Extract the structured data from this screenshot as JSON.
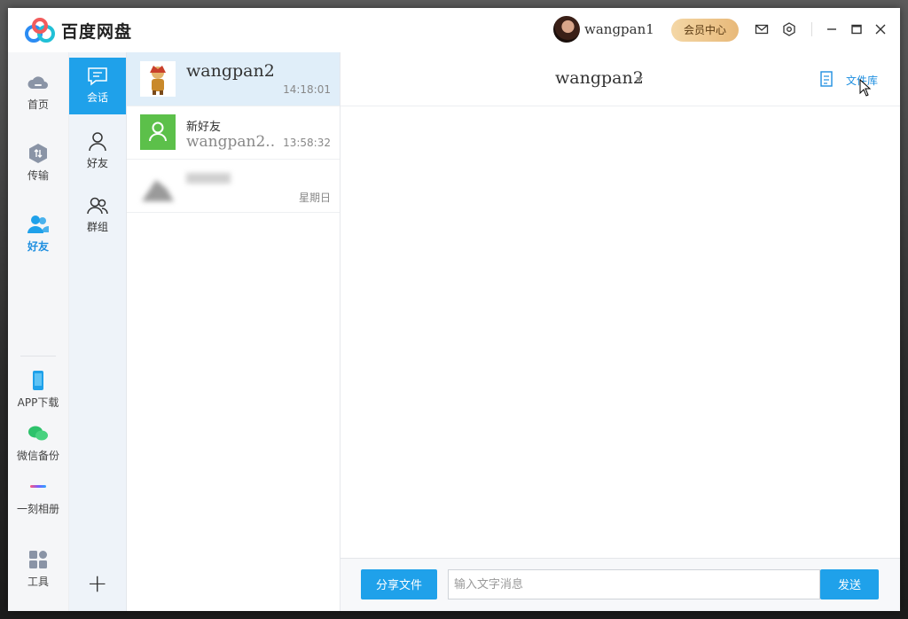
{
  "app": {
    "brand": "百度网盘"
  },
  "header": {
    "username": "wangpan1",
    "vip_label": "会员中心",
    "icons": [
      "mail-icon",
      "gear-icon",
      "minimize-icon",
      "maximize-icon",
      "close-icon"
    ]
  },
  "leftnav": {
    "items": [
      {
        "label": "首页",
        "icon": "cloud-icon"
      },
      {
        "label": "传输",
        "icon": "transfer-icon"
      },
      {
        "label": "好友",
        "icon": "friends-icon",
        "active": true
      }
    ],
    "bottom_items": [
      {
        "label": "APP下载",
        "icon": "phone-icon"
      },
      {
        "label": "微信备份",
        "icon": "wechat-icon"
      },
      {
        "label": "一刻相册",
        "icon": "album-icon"
      },
      {
        "label": "工具",
        "icon": "tools-icon"
      }
    ]
  },
  "subnav": {
    "items": [
      {
        "label": "会话",
        "icon": "chat-icon",
        "active": true
      },
      {
        "label": "好友",
        "icon": "person-icon"
      },
      {
        "label": "群组",
        "icon": "group-icon"
      }
    ],
    "plus": "+"
  },
  "conversations": [
    {
      "name": "wangpan2",
      "time": "14:18:01",
      "active": true
    },
    {
      "name": "新好友",
      "subtitle": "wangpan2...",
      "time": "13:58:32"
    },
    {
      "name": "",
      "time": "星期日",
      "blurred": true
    }
  ],
  "chat": {
    "title": "wangpan2",
    "library_label": "文件库",
    "share_label": "分享文件",
    "input_placeholder": "输入文字消息",
    "input_value": "",
    "send_label": "发送"
  },
  "colors": {
    "accent": "#1fa1ea",
    "vip_gold": "#e8b979",
    "friend_green": "#5cc04a"
  }
}
